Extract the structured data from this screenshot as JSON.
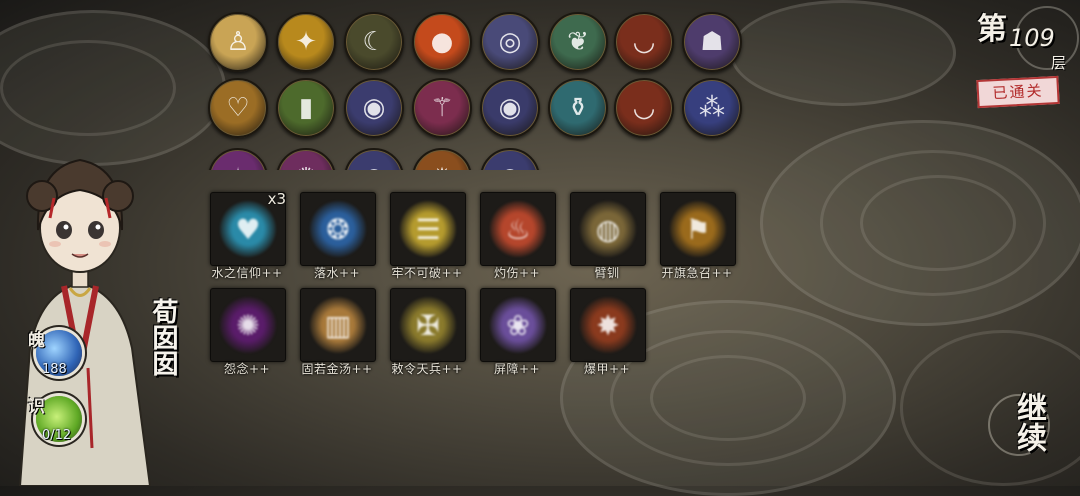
{
  "floor": {
    "prefix": "第",
    "number": "109",
    "unit": "层",
    "status": "已通关"
  },
  "character": {
    "name": "荀囡囡"
  },
  "stats": {
    "soul": {
      "label": "魄",
      "value": "188"
    },
    "knowledge": {
      "label": "识",
      "value": "0/12"
    }
  },
  "relics": [
    {
      "icon": "figure-icon",
      "color": "#c9a455"
    },
    {
      "icon": "golden-figure-icon",
      "color": "#b8891d"
    },
    {
      "icon": "claw-icon",
      "color": "#4a4a2c"
    },
    {
      "icon": "fire-orb-icon",
      "color": "#c44a1c"
    },
    {
      "icon": "spiral-cloud-icon",
      "color": "#494a78"
    },
    {
      "icon": "jade-leaf-icon",
      "color": "#3e6a4e"
    },
    {
      "icon": "bowl-icon",
      "color": "#7a2e1c"
    },
    {
      "icon": "beast-mask-icon",
      "color": "#4e3c6c"
    },
    {
      "icon": "heart-vine-icon",
      "color": "#9b6d25"
    },
    {
      "icon": "stone-tablet-icon",
      "color": "#4d6a2c"
    },
    {
      "icon": "pearl-icon",
      "color": "#3b3c6e"
    },
    {
      "icon": "golden-staff-icon",
      "color": "#7c2d4e"
    },
    {
      "icon": "pearl-icon",
      "color": "#3a3b6a"
    },
    {
      "icon": "vase-icon",
      "color": "#2f6a70"
    },
    {
      "icon": "bowl-icon",
      "color": "#7a2e1c"
    },
    {
      "icon": "bubbles-icon",
      "color": "#373f7e"
    },
    {
      "icon": "purple-relic-icon",
      "color": "#6a2c6e"
    },
    {
      "icon": "purple-gold-icon",
      "color": "#6e2d5e"
    },
    {
      "icon": "pearl-icon",
      "color": "#3b3c6e"
    },
    {
      "icon": "bronze-relic-icon",
      "color": "#8a4e1e"
    },
    {
      "icon": "pearl-icon",
      "color": "#3b3c6e"
    }
  ],
  "skills": [
    {
      "name": "水之信仰++",
      "count": "x3",
      "icon": "water-heart-icon",
      "color": "#2a8aa8"
    },
    {
      "name": "落水++",
      "count": "",
      "icon": "water-bubbles-icon",
      "color": "#2b5f9c"
    },
    {
      "name": "牢不可破++",
      "count": "",
      "icon": "golden-barrier-icon",
      "color": "#b59b2e"
    },
    {
      "name": "灼伤++",
      "count": "",
      "icon": "flame-icon",
      "color": "#b5462c"
    },
    {
      "name": "臂钏",
      "count": "",
      "icon": "bracelet-icon",
      "color": "#7a6638"
    },
    {
      "name": "开旗急召++",
      "count": "",
      "icon": "flag-summon-icon",
      "color": "#9a6a1c"
    },
    {
      "name": "怨念++",
      "count": "",
      "icon": "dark-vortex-icon",
      "color": "#5a1c6a"
    },
    {
      "name": "固若金汤++",
      "count": "",
      "icon": "golden-wall-icon",
      "color": "#a8793a"
    },
    {
      "name": "敕令天兵++",
      "count": "",
      "icon": "decree-icon",
      "color": "#8a7a2c"
    },
    {
      "name": "屏障++",
      "count": "",
      "icon": "lotus-shield-icon",
      "color": "#6a4e9a"
    },
    {
      "name": "爆甲++",
      "count": "",
      "icon": "armor-burst-icon",
      "color": "#8a3a1e"
    }
  ],
  "continue_button": {
    "label": "继续"
  },
  "glyphs": {
    "figure-icon": "♙",
    "golden-figure-icon": "✦",
    "claw-icon": "☾",
    "fire-orb-icon": "●",
    "spiral-cloud-icon": "◎",
    "jade-leaf-icon": "❦",
    "bowl-icon": "◡",
    "beast-mask-icon": "☗",
    "heart-vine-icon": "♡",
    "stone-tablet-icon": "▮",
    "pearl-icon": "◉",
    "golden-staff-icon": "⚚",
    "vase-icon": "⚱",
    "bubbles-icon": "⁂",
    "purple-relic-icon": "✧",
    "purple-gold-icon": "✺",
    "bronze-relic-icon": "✹",
    "water-heart-icon": "♥",
    "water-bubbles-icon": "❂",
    "golden-barrier-icon": "☰",
    "flame-icon": "♨",
    "bracelet-icon": "◍",
    "flag-summon-icon": "⚑",
    "dark-vortex-icon": "✺",
    "golden-wall-icon": "▥",
    "decree-icon": "✠",
    "lotus-shield-icon": "❀",
    "armor-burst-icon": "✸"
  }
}
